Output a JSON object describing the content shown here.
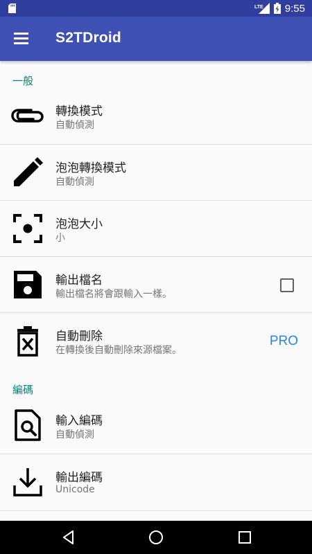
{
  "status_bar": {
    "time": "9:55",
    "network": "LTE",
    "icons": [
      "sd-card-icon",
      "signal-icon",
      "battery-charging-icon"
    ]
  },
  "app_bar": {
    "title": "S2TDroid",
    "menu_icon": "hamburger-menu-icon"
  },
  "sections": {
    "general": "一般",
    "encoding": "編碼"
  },
  "items": {
    "convert_mode": {
      "title": "轉換模式",
      "subtitle": "自動偵測",
      "icon": "paperclip-icon"
    },
    "bubble_convert_mode": {
      "title": "泡泡轉換模式",
      "subtitle": "自動偵測",
      "icon": "pencil-icon"
    },
    "bubble_size": {
      "title": "泡泡大小",
      "subtitle": "小",
      "icon": "center-focus-icon"
    },
    "output_filename": {
      "title": "輸出檔名",
      "subtitle": "輸出檔名將會跟輸入一樣。",
      "icon": "floppy-save-icon",
      "checked": false
    },
    "auto_delete": {
      "title": "自動刪除",
      "subtitle": "在轉換後自動刪除來源檔案。",
      "icon": "trash-delete-icon",
      "badge": "PRO"
    },
    "input_encoding": {
      "title": "輸入編碼",
      "subtitle": "自動偵測",
      "icon": "file-search-icon"
    },
    "output_encoding": {
      "title": "輸出編碼",
      "subtitle": "Unicode",
      "icon": "download-icon"
    }
  },
  "colors": {
    "status_bar": "#303f9f",
    "app_bar": "#3f51b5",
    "section_header": "#00897b",
    "pro_badge": "#1e88e5",
    "background": "#fafafa"
  },
  "nav_bar": {
    "buttons": [
      "back-icon",
      "home-icon",
      "recents-icon"
    ]
  }
}
